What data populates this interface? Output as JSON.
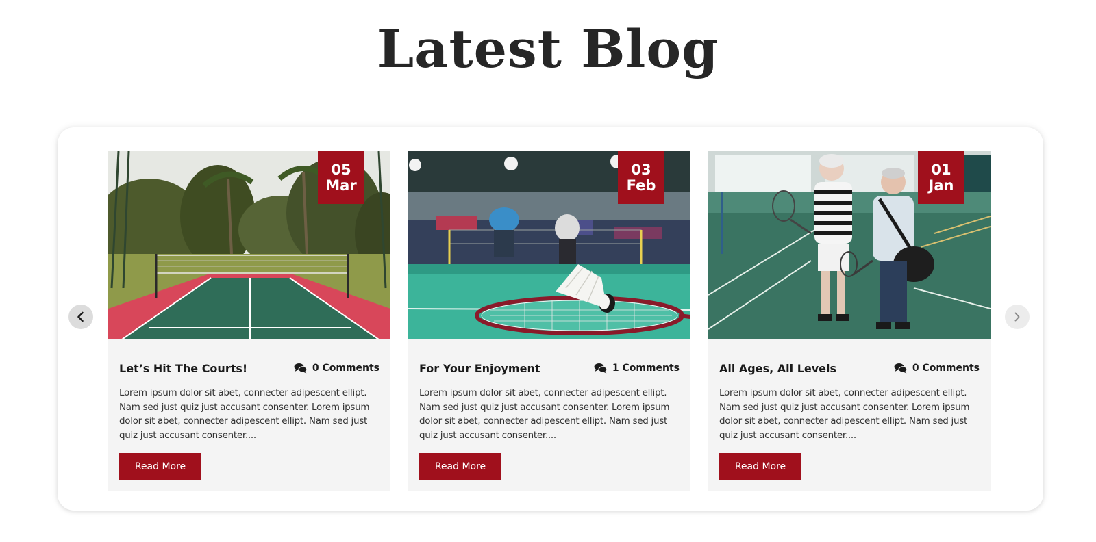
{
  "section": {
    "title": "Latest Blog"
  },
  "carousel": {
    "prev_icon": "chevron-left-icon",
    "next_icon": "chevron-right-icon"
  },
  "posts": [
    {
      "day": "05",
      "month": "Mar",
      "title": "Let’s Hit The Courts!",
      "comments": "0 Comments",
      "excerpt": "Lorem ipsum dolor sit abet, connecter adipescent ellipt. Nam sed just quiz just accusant consenter. Lorem ipsum dolor sit abet, connecter adipescent ellipt. Nam sed just quiz just accusant consenter....",
      "button": "Read More"
    },
    {
      "day": "03",
      "month": "Feb",
      "title": "For Your Enjoyment",
      "comments": "1 Comments",
      "excerpt": "Lorem ipsum dolor sit abet, connecter adipescent ellipt. Nam sed just quiz just accusant consenter. Lorem ipsum dolor sit abet, connecter adipescent ellipt. Nam sed just quiz just accusant consenter....",
      "button": "Read More"
    },
    {
      "day": "01",
      "month": "Jan",
      "title": "All Ages, All Levels",
      "comments": "0 Comments",
      "excerpt": "Lorem ipsum dolor sit abet, connecter adipescent ellipt. Nam sed just quiz just accusant consenter. Lorem ipsum dolor sit abet, connecter adipescent ellipt. Nam sed just quiz just accusant consenter....",
      "button": "Read More"
    }
  ],
  "colors": {
    "accent": "#a0101c",
    "card_background": "#f4f4f4",
    "title_text": "#262626"
  }
}
